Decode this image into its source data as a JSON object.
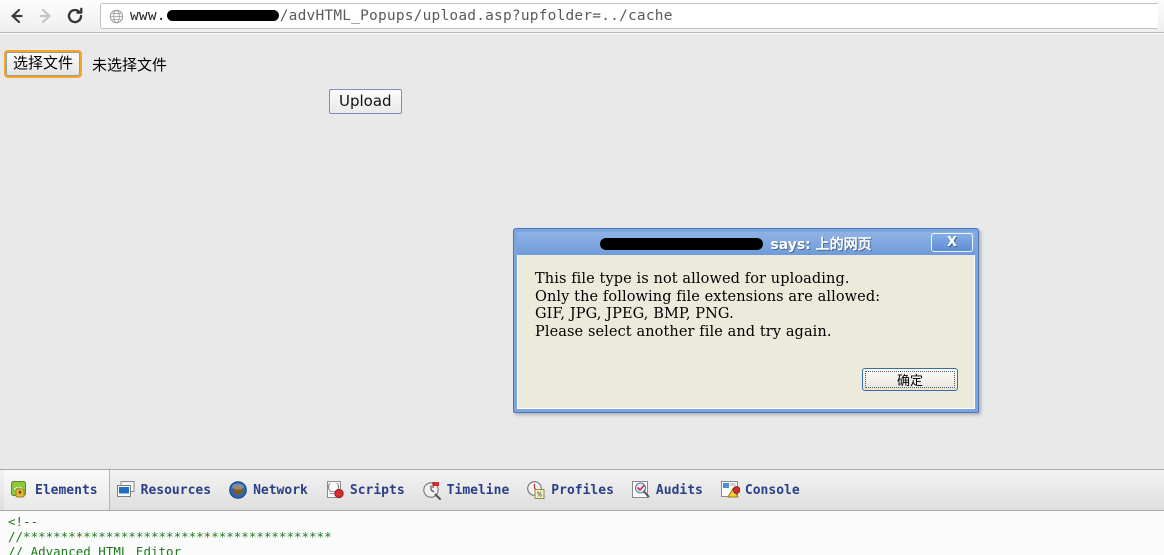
{
  "browser": {
    "back_icon": "back-arrow-icon",
    "forward_icon": "forward-arrow-icon",
    "reload_icon": "reload-icon",
    "page_icon": "globe-icon",
    "url_prefix": "www.",
    "url_suffix": "/advHTML_Popups/upload.asp?upfolder=../cache",
    "url_host_redacted": true
  },
  "page": {
    "file_input": {
      "button_label": "选择文件",
      "status_text": "未选择文件",
      "focused": true,
      "focus_color": "#f5a623"
    },
    "upload_button_label": "Upload"
  },
  "dialog": {
    "title_suffix": "says: 上的网页",
    "title_host_redacted": true,
    "close_label": "X",
    "message": "This file type is not allowed for uploading.\nOnly the following file extensions are allowed:\nGIF, JPG, JPEG, BMP, PNG.\nPlease select another file and try again.",
    "ok_label": "确定",
    "title_bar_color": "#7ca5dd",
    "body_color": "#eceadb"
  },
  "devtools": {
    "tabs": [
      {
        "label": "Elements",
        "icon": "elements-icon",
        "selected": true
      },
      {
        "label": "Resources",
        "icon": "resources-icon",
        "selected": false
      },
      {
        "label": "Network",
        "icon": "network-icon",
        "selected": false
      },
      {
        "label": "Scripts",
        "icon": "scripts-icon",
        "selected": false
      },
      {
        "label": "Timeline",
        "icon": "timeline-icon",
        "selected": false
      },
      {
        "label": "Profiles",
        "icon": "profiles-icon",
        "selected": false
      },
      {
        "label": "Audits",
        "icon": "audits-icon",
        "selected": false
      },
      {
        "label": "Console",
        "icon": "console-icon",
        "selected": false
      }
    ],
    "source_lines": "<!--\n//*****************************************\n// Advanced HTML Editor"
  }
}
